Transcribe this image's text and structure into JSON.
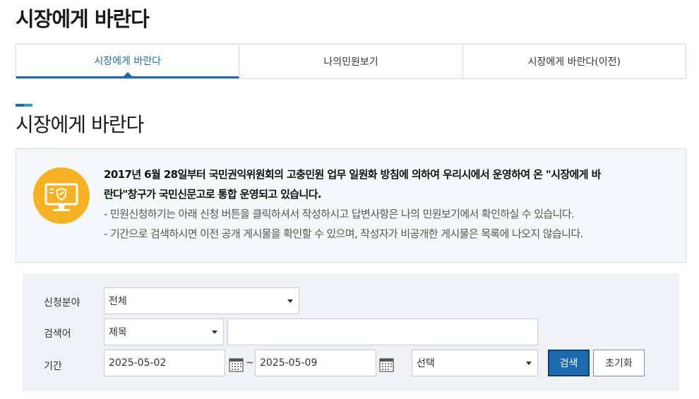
{
  "page": {
    "title": "시장에게 바란다"
  },
  "tabs": [
    {
      "label": "시장에게 바란다",
      "active": true
    },
    {
      "label": "나의민원보기",
      "active": false
    },
    {
      "label": "시장에게 바란다(이전)",
      "active": false
    }
  ],
  "section": {
    "title": "시장에게 바란다"
  },
  "notice": {
    "icon": "monitor-shield-icon",
    "strong_line1": "2017년 6월 28일부터 국민권익위원회의 고충민원 업무 일원화 방침에 의하여 우리시에서 운영하여 온 \"시장에게 바",
    "strong_line2": "란다\"창구가 국민신문고로 통합 운영되고 있습니다.",
    "line1": "- 민원신청하기는 아래 신청 버튼을 클릭하셔서 작성하시고 답변사항은 나의 민원보기에서 확인하실 수 있습니다.",
    "line2": "- 기간으로 검색하시면 이전 공개 게시물을 확인할 수 있으며, 작성자가 비공개한 게시물은 목록에 나오지 않습니다."
  },
  "search": {
    "category_label": "신청분야",
    "category_value": "전체",
    "keyword_label": "검색어",
    "keyword_field_value": "제목",
    "keyword_value": "",
    "period_label": "기간",
    "date_from": "2025-05-02",
    "date_to": "2025-05-09",
    "tilde": "~",
    "period_select_value": "선택",
    "search_button": "검색",
    "reset_button": "초기화"
  },
  "colors": {
    "accent": "#1c6bb0",
    "icon_bg": "#f5b324",
    "panel_bg": "#f0f1f4"
  }
}
